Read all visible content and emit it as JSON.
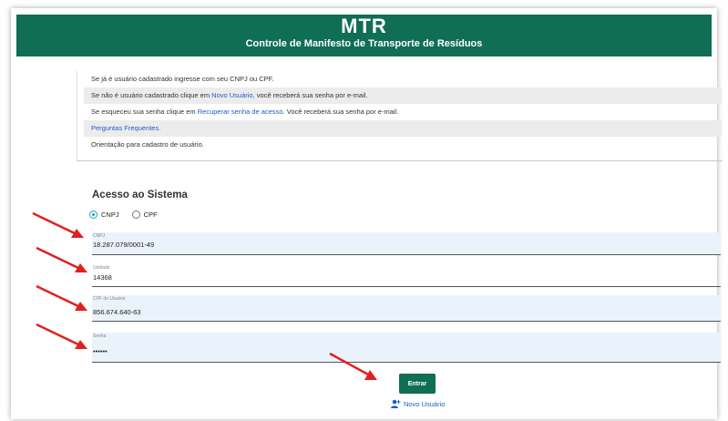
{
  "header": {
    "title": "MTR",
    "subtitle": "Controle de Manifesto de Transporte de Resíduos"
  },
  "info": {
    "line1": "Se já é usuário cadastrado ingresse com seu CNPJ ou CPF.",
    "line2_pre": "Se não é usuário cadastrado clique em ",
    "line2_link": "Novo Usuário",
    "line2_post": ", você receberá sua senha por e-mail.",
    "line3_pre": "Se esqueceu sua senha clique em ",
    "line3_link": "Recuperar senha de acesso",
    "line3_post": ". Você receberá sua senha por e-mail.",
    "line4_link": "Perguntas Frequentes.",
    "line5": "Orientação para cadastro de usuário."
  },
  "access": {
    "title": "Acesso ao Sistema",
    "radio_cnpj": "CNPJ",
    "radio_cpf": "CPF",
    "selected": "CNPJ"
  },
  "fields": {
    "cnpj_label": "CNPJ",
    "cnpj_value": "18.287.079/0001-49",
    "unidade_label": "Unidade",
    "unidade_value": "14368",
    "cpf_label": "CPF do Usuário",
    "cpf_value": "856.674.640-63",
    "senha_label": "Senha",
    "senha_value": "••••••"
  },
  "buttons": {
    "entrar": "Entrar",
    "novo_usuario": "Novo Usuário"
  },
  "colors": {
    "brand": "#0f6e55",
    "link": "#1a5fc6",
    "arrow": "#e02020",
    "radio_selected": "#18a6c4"
  },
  "icons": {
    "novo_usuario": "user-add-icon",
    "annotation": "red-arrow-icon"
  }
}
